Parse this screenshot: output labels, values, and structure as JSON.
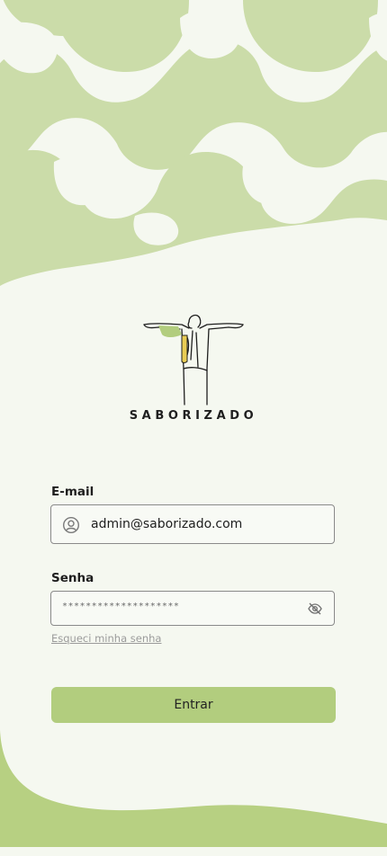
{
  "app": {
    "brand_name": "SABORIZADO",
    "logo_icon": "christ-the-redeemer-icon"
  },
  "colors": {
    "background": "#f5f8f0",
    "pattern_green": "#cbdca9",
    "accent_green": "#b2cd7e",
    "bottom_wave_green": "#b7d082"
  },
  "login_form": {
    "email": {
      "label": "E-mail",
      "value": "admin@saborizado.com",
      "icon": "user-circle-icon"
    },
    "password": {
      "label": "Senha",
      "value": "********************",
      "icon": "eye-off-icon"
    },
    "forgot_link": "Esqueci minha senha",
    "submit_label": "Entrar"
  }
}
